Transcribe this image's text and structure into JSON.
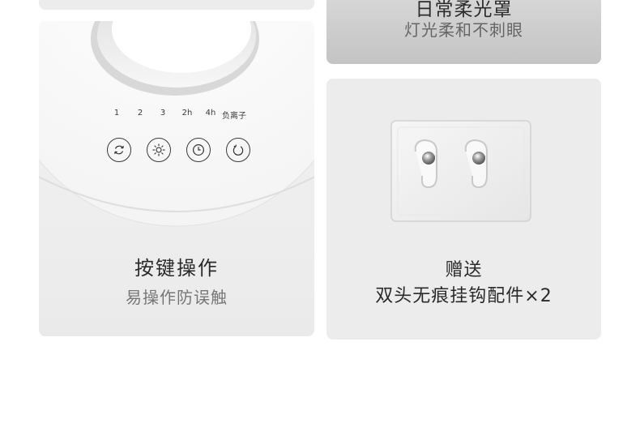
{
  "card_top_right": {
    "title": "日常柔光罩",
    "subtitle": "灯光柔和不刺眼"
  },
  "card_buttons": {
    "step_labels": [
      "1",
      "2",
      "3",
      "2h",
      "4h",
      "负离子"
    ],
    "buttons": [
      {
        "icon": "rotate-icon"
      },
      {
        "icon": "sun-icon"
      },
      {
        "icon": "clock-icon"
      },
      {
        "icon": "power-icon"
      }
    ],
    "title": "按键操作",
    "subtitle": "易操作防误触"
  },
  "card_hooks": {
    "title": "赠送",
    "subtitle": "双头无痕挂钩配件×2"
  }
}
